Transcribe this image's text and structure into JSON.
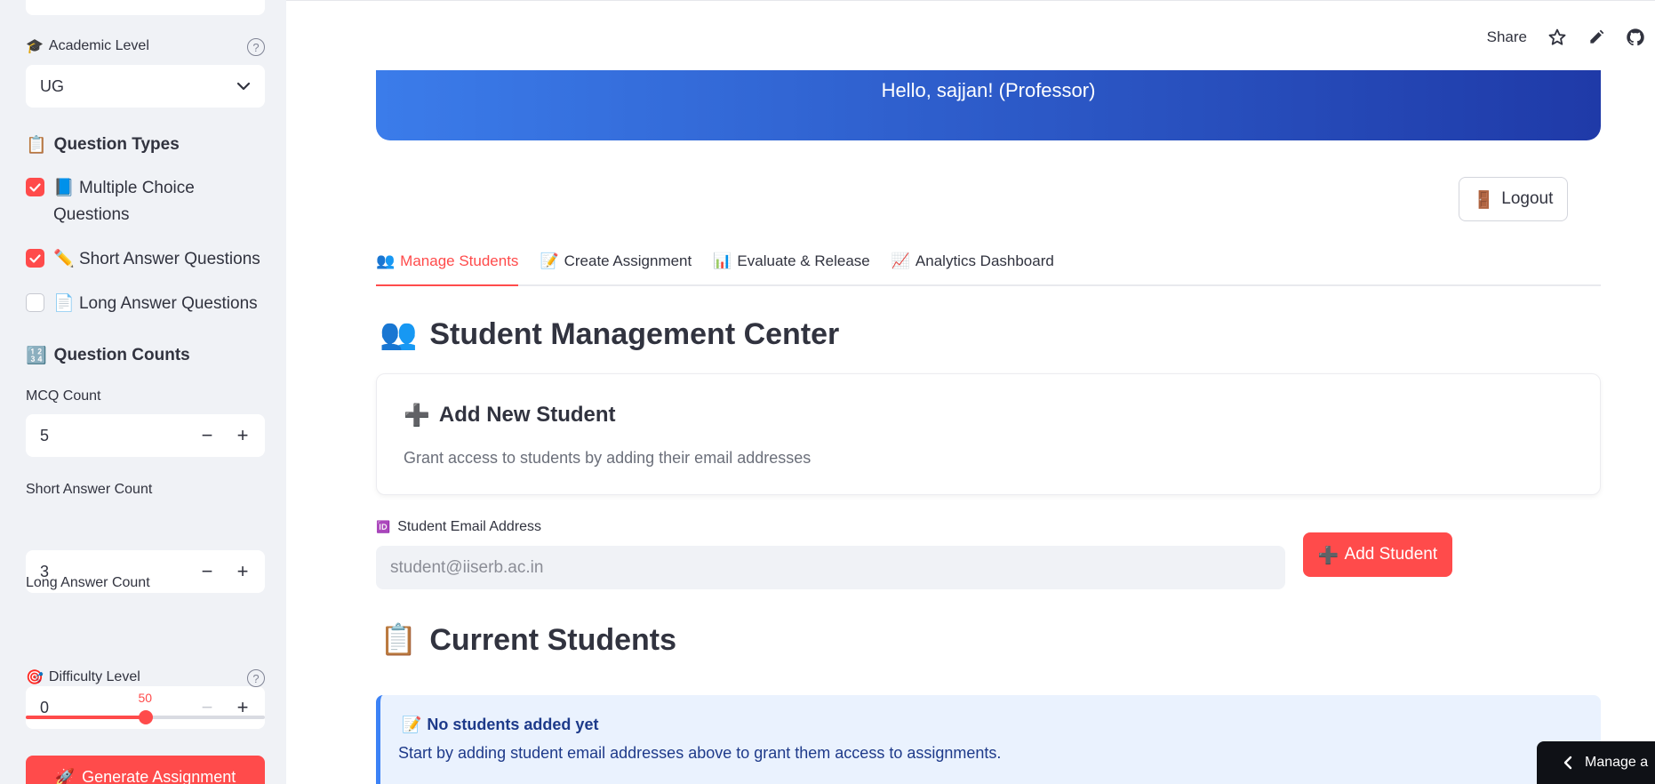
{
  "sidebar": {
    "academic_level": {
      "label": "Academic Level",
      "emoji": "🎓",
      "value": "UG",
      "help": "?"
    },
    "question_types": {
      "title": "Question Types",
      "emoji": "📋",
      "items": [
        {
          "emoji": "📘",
          "label": "Multiple Choice Questions",
          "checked": true
        },
        {
          "emoji": "✏️",
          "label": "Short Answer Questions",
          "checked": true
        },
        {
          "emoji": "📄",
          "label": "Long Answer Questions",
          "checked": false
        }
      ]
    },
    "question_counts": {
      "title": "Question Counts",
      "emoji": "🔢",
      "fields": [
        {
          "label": "MCQ Count",
          "value": "5",
          "minus_disabled": false
        },
        {
          "label": "Short Answer Count",
          "value": "3",
          "minus_disabled": false
        },
        {
          "label": "Long Answer Count",
          "value": "0",
          "minus_disabled": true
        }
      ]
    },
    "difficulty": {
      "label": "Difficulty Level",
      "emoji": "🎯",
      "value": "50",
      "fraction": 0.5,
      "help": "?"
    },
    "generate_button": {
      "label": "Generate Assignment",
      "emoji": "🚀"
    }
  },
  "toolbar": {
    "share": "Share",
    "icons": [
      "star-icon",
      "edit-icon",
      "github-icon"
    ]
  },
  "banner": {
    "greeting": "Hello, sajjan! (Professor)"
  },
  "logout": {
    "label": "Logout",
    "emoji": "🚪"
  },
  "tabs": [
    {
      "emoji": "👥",
      "label": "Manage Students",
      "active": true
    },
    {
      "emoji": "📝",
      "label": "Create Assignment",
      "active": false
    },
    {
      "emoji": "📊",
      "label": "Evaluate & Release",
      "active": false
    },
    {
      "emoji": "📈",
      "label": "Analytics Dashboard",
      "active": false
    }
  ],
  "main": {
    "heading": {
      "emoji": "👥",
      "text": "Student Management Center"
    },
    "add_card": {
      "title": "Add New Student",
      "title_emoji": "➕",
      "subtitle": "Grant access to students by adding their email addresses"
    },
    "email": {
      "emoji": "🆔",
      "label": "Student Email Address",
      "placeholder": "student@iiserb.ac.in",
      "value": ""
    },
    "add_button": {
      "emoji": "➕",
      "label": "Add Student"
    },
    "current_heading": {
      "emoji": "📋",
      "text": "Current Students"
    },
    "info": {
      "emoji": "📝",
      "title": "No students added yet",
      "text": "Start by adding student email addresses above to grant them access to assignments."
    },
    "corner_tab": {
      "label": "Manage a"
    }
  },
  "colors": {
    "accent": "#ff4b4b",
    "banner_start": "#3b7cea",
    "banner_end": "#1f3aa8",
    "info_bg": "#eaf2fe",
    "info_border": "#3c82f6"
  }
}
